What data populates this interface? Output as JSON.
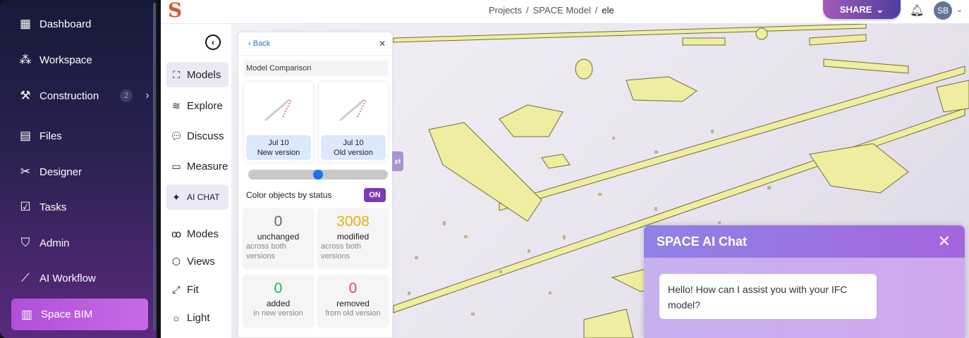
{
  "sidebar": {
    "items": [
      {
        "label": "Dashboard",
        "icon": "dashboard-icon"
      },
      {
        "label": "Workspace",
        "icon": "workspace-icon"
      },
      {
        "label": "Construction",
        "icon": "tools-icon",
        "badge": "2"
      },
      {
        "label": "Files",
        "icon": "file-icon"
      },
      {
        "label": "Designer",
        "icon": "designer-icon"
      },
      {
        "label": "Tasks",
        "icon": "tasks-icon"
      },
      {
        "label": "Admin",
        "icon": "admin-icon"
      },
      {
        "label": "AI Workflow",
        "icon": "workflow-icon"
      },
      {
        "label": "Space BIM",
        "icon": "chart-icon",
        "active": true
      }
    ]
  },
  "header": {
    "breadcrumb": [
      "Projects",
      "SPACE Model",
      "ele"
    ],
    "share": "SHARE",
    "avatar": "SB"
  },
  "tools": [
    "Models",
    "Explore",
    "Discuss",
    "Measure",
    "AI CHAT",
    "Modes",
    "Views",
    "Fit",
    "Light"
  ],
  "panel": {
    "back": "Back",
    "title": "Model Comparison",
    "versions": [
      {
        "date": "Jul 10",
        "label": "New version"
      },
      {
        "date": "Jul 10",
        "label": "Old version"
      }
    ],
    "slider_value": 0.5,
    "color_by_status": "Color objects by status",
    "toggle": "ON",
    "stats": [
      {
        "value": "0",
        "label": "unchanged",
        "sub": "across both versions",
        "color": "#666666"
      },
      {
        "value": "3008",
        "label": "modified",
        "sub": "across both versions",
        "color": "#e6b012"
      },
      {
        "value": "0",
        "label": "added",
        "sub": "in new version",
        "color": "#22b45a"
      },
      {
        "value": "0",
        "label": "removed",
        "sub": "from old version",
        "color": "#e8455a"
      }
    ]
  },
  "chat": {
    "title": "SPACE AI Chat",
    "message": "Hello! How can I assist you with your IFC model?"
  }
}
